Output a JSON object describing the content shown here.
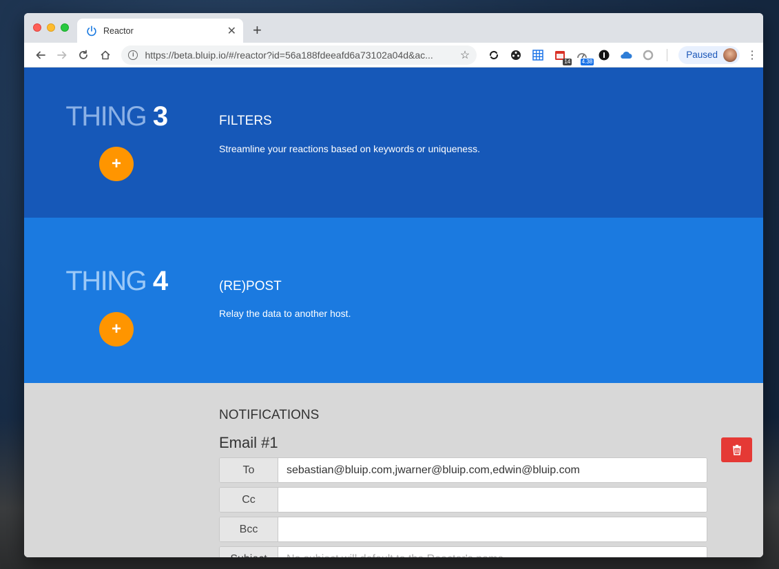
{
  "browser": {
    "tab_title": "Reactor",
    "new_tab_label": "+",
    "url": "https://beta.bluip.io/#/reactor?id=56a188fdeeafd6a73102a04d&ac...",
    "profile_status": "Paused",
    "extensions": [
      {
        "name": "sync-icon"
      },
      {
        "name": "film-reel-icon"
      },
      {
        "name": "grid-icon"
      },
      {
        "name": "calendar-icon",
        "badge": "14"
      },
      {
        "name": "speed-icon",
        "badge": "4.38"
      },
      {
        "name": "onepassword-icon"
      },
      {
        "name": "cloud-icon"
      },
      {
        "name": "circle-icon"
      }
    ]
  },
  "colors": {
    "section3_bg": "#1658b8",
    "section4_bg": "#1b7ae0",
    "accent_orange": "#ff9500",
    "delete_red": "#e53935"
  },
  "sections": {
    "thing3": {
      "word": "THING",
      "num": "3",
      "heading": "FILTERS",
      "description": "Streamline your reactions based on keywords or uniqueness.",
      "add_label": "+"
    },
    "thing4": {
      "word": "THING",
      "num": "4",
      "heading": "(RE)POST",
      "description": "Relay the data to another host.",
      "add_label": "+"
    }
  },
  "notifications": {
    "heading": "NOTIFICATIONS",
    "email_title": "Email #1",
    "fields": {
      "to_label": "To",
      "to_value": "sebastian@bluip.com,jwarner@bluip.com,edwin@bluip.com",
      "cc_label": "Cc",
      "cc_value": "",
      "bcc_label": "Bcc",
      "bcc_value": "",
      "subject_label": "Subject",
      "subject_placeholder": "No subject will default to the Reactor's name"
    }
  }
}
